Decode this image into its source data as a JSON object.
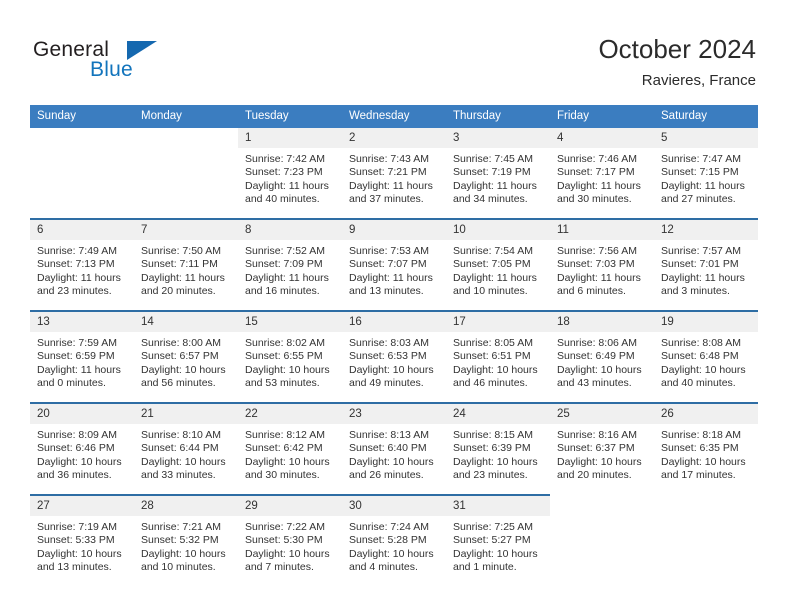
{
  "brand": {
    "name_part1": "General",
    "name_part2": "Blue",
    "triangle_color": "#1568af",
    "blue_color": "#1274bc"
  },
  "header": {
    "title": "October 2024",
    "subtitle": "Ravieres, France"
  },
  "theme": {
    "header_bg": "#3b7dc0",
    "week_divider": "#2e6da4",
    "daynum_bg": "#f0f0f0",
    "text": "#333333"
  },
  "weekdays": [
    "Sunday",
    "Monday",
    "Tuesday",
    "Wednesday",
    "Thursday",
    "Friday",
    "Saturday"
  ],
  "labels": {
    "sunrise": "Sunrise:",
    "sunset": "Sunset:",
    "daylight": "Daylight:"
  },
  "weeks": [
    [
      {
        "empty": true
      },
      {
        "empty": true
      },
      {
        "day": "1",
        "sunrise": "Sunrise: 7:42 AM",
        "sunset": "Sunset: 7:23 PM",
        "daylight": "Daylight: 11 hours and 40 minutes."
      },
      {
        "day": "2",
        "sunrise": "Sunrise: 7:43 AM",
        "sunset": "Sunset: 7:21 PM",
        "daylight": "Daylight: 11 hours and 37 minutes."
      },
      {
        "day": "3",
        "sunrise": "Sunrise: 7:45 AM",
        "sunset": "Sunset: 7:19 PM",
        "daylight": "Daylight: 11 hours and 34 minutes."
      },
      {
        "day": "4",
        "sunrise": "Sunrise: 7:46 AM",
        "sunset": "Sunset: 7:17 PM",
        "daylight": "Daylight: 11 hours and 30 minutes."
      },
      {
        "day": "5",
        "sunrise": "Sunrise: 7:47 AM",
        "sunset": "Sunset: 7:15 PM",
        "daylight": "Daylight: 11 hours and 27 minutes."
      }
    ],
    [
      {
        "day": "6",
        "sunrise": "Sunrise: 7:49 AM",
        "sunset": "Sunset: 7:13 PM",
        "daylight": "Daylight: 11 hours and 23 minutes."
      },
      {
        "day": "7",
        "sunrise": "Sunrise: 7:50 AM",
        "sunset": "Sunset: 7:11 PM",
        "daylight": "Daylight: 11 hours and 20 minutes."
      },
      {
        "day": "8",
        "sunrise": "Sunrise: 7:52 AM",
        "sunset": "Sunset: 7:09 PM",
        "daylight": "Daylight: 11 hours and 16 minutes."
      },
      {
        "day": "9",
        "sunrise": "Sunrise: 7:53 AM",
        "sunset": "Sunset: 7:07 PM",
        "daylight": "Daylight: 11 hours and 13 minutes."
      },
      {
        "day": "10",
        "sunrise": "Sunrise: 7:54 AM",
        "sunset": "Sunset: 7:05 PM",
        "daylight": "Daylight: 11 hours and 10 minutes."
      },
      {
        "day": "11",
        "sunrise": "Sunrise: 7:56 AM",
        "sunset": "Sunset: 7:03 PM",
        "daylight": "Daylight: 11 hours and 6 minutes."
      },
      {
        "day": "12",
        "sunrise": "Sunrise: 7:57 AM",
        "sunset": "Sunset: 7:01 PM",
        "daylight": "Daylight: 11 hours and 3 minutes."
      }
    ],
    [
      {
        "day": "13",
        "sunrise": "Sunrise: 7:59 AM",
        "sunset": "Sunset: 6:59 PM",
        "daylight": "Daylight: 11 hours and 0 minutes."
      },
      {
        "day": "14",
        "sunrise": "Sunrise: 8:00 AM",
        "sunset": "Sunset: 6:57 PM",
        "daylight": "Daylight: 10 hours and 56 minutes."
      },
      {
        "day": "15",
        "sunrise": "Sunrise: 8:02 AM",
        "sunset": "Sunset: 6:55 PM",
        "daylight": "Daylight: 10 hours and 53 minutes."
      },
      {
        "day": "16",
        "sunrise": "Sunrise: 8:03 AM",
        "sunset": "Sunset: 6:53 PM",
        "daylight": "Daylight: 10 hours and 49 minutes."
      },
      {
        "day": "17",
        "sunrise": "Sunrise: 8:05 AM",
        "sunset": "Sunset: 6:51 PM",
        "daylight": "Daylight: 10 hours and 46 minutes."
      },
      {
        "day": "18",
        "sunrise": "Sunrise: 8:06 AM",
        "sunset": "Sunset: 6:49 PM",
        "daylight": "Daylight: 10 hours and 43 minutes."
      },
      {
        "day": "19",
        "sunrise": "Sunrise: 8:08 AM",
        "sunset": "Sunset: 6:48 PM",
        "daylight": "Daylight: 10 hours and 40 minutes."
      }
    ],
    [
      {
        "day": "20",
        "sunrise": "Sunrise: 8:09 AM",
        "sunset": "Sunset: 6:46 PM",
        "daylight": "Daylight: 10 hours and 36 minutes."
      },
      {
        "day": "21",
        "sunrise": "Sunrise: 8:10 AM",
        "sunset": "Sunset: 6:44 PM",
        "daylight": "Daylight: 10 hours and 33 minutes."
      },
      {
        "day": "22",
        "sunrise": "Sunrise: 8:12 AM",
        "sunset": "Sunset: 6:42 PM",
        "daylight": "Daylight: 10 hours and 30 minutes."
      },
      {
        "day": "23",
        "sunrise": "Sunrise: 8:13 AM",
        "sunset": "Sunset: 6:40 PM",
        "daylight": "Daylight: 10 hours and 26 minutes."
      },
      {
        "day": "24",
        "sunrise": "Sunrise: 8:15 AM",
        "sunset": "Sunset: 6:39 PM",
        "daylight": "Daylight: 10 hours and 23 minutes."
      },
      {
        "day": "25",
        "sunrise": "Sunrise: 8:16 AM",
        "sunset": "Sunset: 6:37 PM",
        "daylight": "Daylight: 10 hours and 20 minutes."
      },
      {
        "day": "26",
        "sunrise": "Sunrise: 8:18 AM",
        "sunset": "Sunset: 6:35 PM",
        "daylight": "Daylight: 10 hours and 17 minutes."
      }
    ],
    [
      {
        "day": "27",
        "sunrise": "Sunrise: 7:19 AM",
        "sunset": "Sunset: 5:33 PM",
        "daylight": "Daylight: 10 hours and 13 minutes."
      },
      {
        "day": "28",
        "sunrise": "Sunrise: 7:21 AM",
        "sunset": "Sunset: 5:32 PM",
        "daylight": "Daylight: 10 hours and 10 minutes."
      },
      {
        "day": "29",
        "sunrise": "Sunrise: 7:22 AM",
        "sunset": "Sunset: 5:30 PM",
        "daylight": "Daylight: 10 hours and 7 minutes."
      },
      {
        "day": "30",
        "sunrise": "Sunrise: 7:24 AM",
        "sunset": "Sunset: 5:28 PM",
        "daylight": "Daylight: 10 hours and 4 minutes."
      },
      {
        "day": "31",
        "sunrise": "Sunrise: 7:25 AM",
        "sunset": "Sunset: 5:27 PM",
        "daylight": "Daylight: 10 hours and 1 minute."
      },
      {
        "empty": true
      },
      {
        "empty": true
      }
    ]
  ]
}
